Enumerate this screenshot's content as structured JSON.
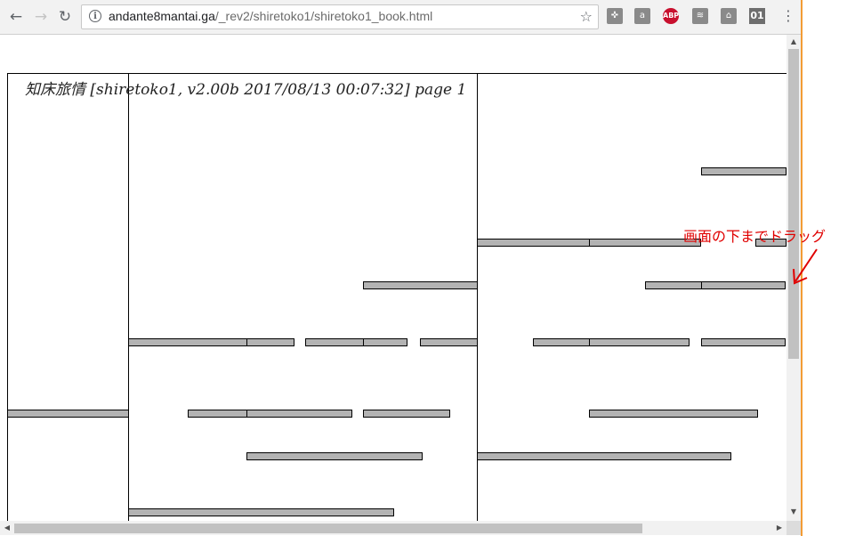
{
  "browser": {
    "url_host": "andante8mantai.ga",
    "url_path": "/_rev2/shiretoko1/shiretoko1_book.html",
    "back_icon": "←",
    "forward_icon": "→",
    "reload_icon": "↻",
    "info_icon": "i",
    "star_icon": "☆",
    "menu_icon": "⋮",
    "extensions": [
      {
        "name": "puzzle-extension-icon",
        "label": "✜"
      },
      {
        "name": "shopping-bag-extension-icon",
        "label": "a"
      },
      {
        "name": "adblock-plus-icon",
        "label": "ABP"
      },
      {
        "name": "cast-icon",
        "label": "≋"
      },
      {
        "name": "pdf-extension-icon",
        "label": "⌂"
      },
      {
        "name": "binary-extension-icon",
        "label": "01"
      }
    ]
  },
  "page": {
    "title": "知床旅情 [shiretoko1, v2.00b 2017/08/13 00:07:32] page 1"
  },
  "annotation": {
    "text": "画面の下までドラッグ",
    "color": "#e00000"
  },
  "scrollbars": {
    "up_arrow": "▲",
    "down_arrow": "▼",
    "left_arrow": "◀",
    "right_arrow": "▶"
  }
}
